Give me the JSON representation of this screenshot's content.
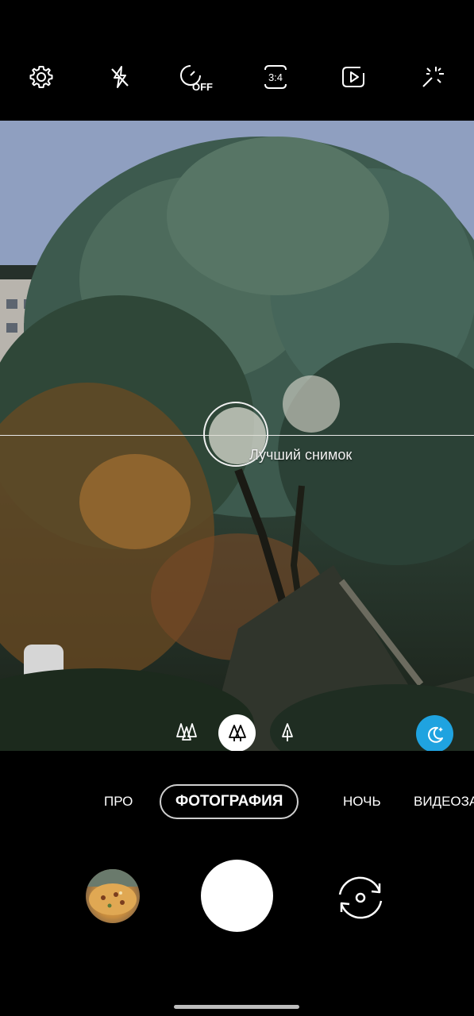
{
  "top_bar": {
    "icons": [
      "gear-icon",
      "flash-off-icon",
      "timer-off-icon",
      "aspect-ratio-icon",
      "motion-photo-icon",
      "filter-effects-icon"
    ],
    "aspect_ratio": "3:4",
    "timer_state": "OFF"
  },
  "viewfinder": {
    "best_shot_label": "Лучший снимок"
  },
  "scene_optimizer": {
    "options": [
      "wide-angle-trees-icon",
      "standard-trees-icon",
      "tele-tree-icon"
    ],
    "selected_index": 1,
    "night_button_color": "#1fa3e0"
  },
  "modes": {
    "items": [
      "ПРО",
      "ФОТОГРАФИЯ",
      "НОЧЬ",
      "ВИДЕОЗА"
    ],
    "active_index": 1
  },
  "colors": {
    "accent_blue": "#1fa3e0",
    "background": "#000000"
  }
}
